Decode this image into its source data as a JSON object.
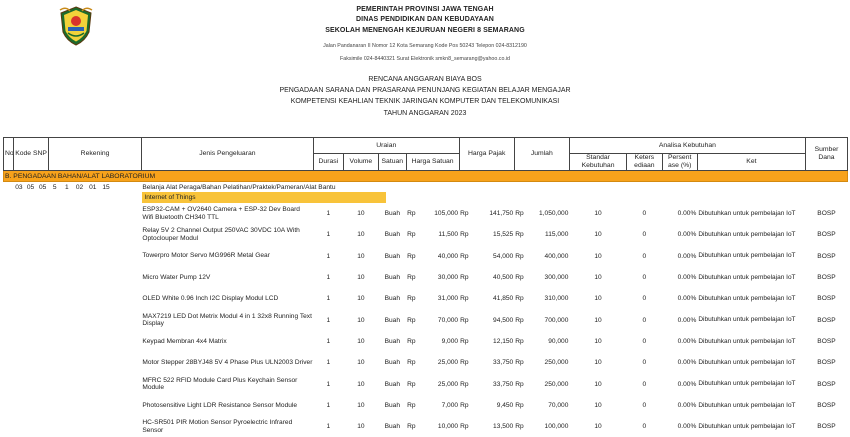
{
  "header": {
    "line1": "PEMERINTAH PROVINSI JAWA TENGAH",
    "line2": "DINAS PENDIDIKAN DAN KEBUDAYAAN",
    "line3": "SEKOLAH MENENGAH KEJURUAN NEGERI 8 SEMARANG",
    "address": "Jalan Pandanaran II Nomor 12 Kota Semarang Kode Pos 50243 Telepon 024-8312190",
    "fax": "Faksimile 024-8440321 Surat Elektronik smkn8_semarang@yahoo.co.id"
  },
  "titles": {
    "t1": "RENCANA ANGGARAN BIAYA BOS",
    "t2": "PENGADAAN SARANA DAN PRASARANA PENUNJANG KEGIATAN BELAJAR MENGAJAR",
    "t3": "KOMPETENSI KEAHLIAN TEKNIK JARINGAN KOMPUTER DAN TELEKOMUNIKASI",
    "t4": "TAHUN ANGGARAN 2023"
  },
  "columns": {
    "no": "No",
    "kode_snp": "Kode SNP",
    "rekening": "Rekening",
    "jenis": "Jenis Pengeluaran",
    "uraian": "Uraian",
    "durasi": "Durasi",
    "volume": "Volume",
    "satuan": "Satuan",
    "harga_satuan": "Harga Satuan",
    "harga_pajak": "Harga Pajak",
    "jumlah": "Jumlah",
    "analisa": "Analisa Kebutuhan",
    "standar": "Standar Kebutuhan",
    "keters": "Keters ediaan",
    "persent": "Persent ase (%)",
    "ket": "Ket",
    "sumber": "Sumber Dana"
  },
  "section": "B. PENGADAAN BAHAN/ALAT LABORATORIUM",
  "rekening_row": {
    "k1": "03",
    "k2": "05",
    "k3": "05",
    "k4": "5",
    "k5": "1",
    "k6": "02",
    "k7": "01",
    "k8": "15",
    "label": "Belanja Alat Peraga/Bahan Pelatihan/Praktek/Pameran/Alat Bantu"
  },
  "group": "Internet of Things",
  "items": [
    {
      "name": "ESP32-CAM + OV2640 Camera + ESP-32 Dev Board Wifi Bluetooth CH340 TTL",
      "durasi": "1",
      "volume": "10",
      "satuan": "Buah",
      "rp1": "Rp",
      "harga": "105,000",
      "rp2": "Rp",
      "pajak": "141,750",
      "rp3": "Rp",
      "jumlah": "1,050,000",
      "standar": "10",
      "ketersediaan": "0",
      "persen": "0.00%",
      "ket": "Dibutuhkan untuk pembelajan IoT",
      "sumber": "BOSP"
    },
    {
      "name": "Relay 5V 2 Channel Output 250VAC 30VDC 10A With Optoclouper Modul",
      "durasi": "1",
      "volume": "10",
      "satuan": "Buah",
      "rp1": "Rp",
      "harga": "11,500",
      "rp2": "Rp",
      "pajak": "15,525",
      "rp3": "Rp",
      "jumlah": "115,000",
      "standar": "10",
      "ketersediaan": "0",
      "persen": "0.00%",
      "ket": "Dibutuhkan untuk pembelajan IoT",
      "sumber": "BOSP"
    },
    {
      "name": "Towerpro Motor Servo MG996R Metal Gear",
      "durasi": "1",
      "volume": "10",
      "satuan": "Buah",
      "rp1": "Rp",
      "harga": "40,000",
      "rp2": "Rp",
      "pajak": "54,000",
      "rp3": "Rp",
      "jumlah": "400,000",
      "standar": "10",
      "ketersediaan": "0",
      "persen": "0.00%",
      "ket": "Dibutuhkan untuk pembelajan IoT",
      "sumber": "BOSP"
    },
    {
      "name": "Micro Water Pump 12V",
      "durasi": "1",
      "volume": "10",
      "satuan": "Buah",
      "rp1": "Rp",
      "harga": "30,000",
      "rp2": "Rp",
      "pajak": "40,500",
      "rp3": "Rp",
      "jumlah": "300,000",
      "standar": "10",
      "ketersediaan": "0",
      "persen": "0.00%",
      "ket": "Dibutuhkan untuk pembelajan IoT",
      "sumber": "BOSP"
    },
    {
      "name": "OLED White 0.96 Inch I2C Display Modul LCD",
      "durasi": "1",
      "volume": "10",
      "satuan": "Buah",
      "rp1": "Rp",
      "harga": "31,000",
      "rp2": "Rp",
      "pajak": "41,850",
      "rp3": "Rp",
      "jumlah": "310,000",
      "standar": "10",
      "ketersediaan": "0",
      "persen": "0.00%",
      "ket": "Dibutuhkan untuk pembelajan IoT",
      "sumber": "BOSP"
    },
    {
      "name": "MAX7219 LED Dot Metrix Modul 4 in 1 32x8 Running Text Display",
      "durasi": "1",
      "volume": "10",
      "satuan": "Buah",
      "rp1": "Rp",
      "harga": "70,000",
      "rp2": "Rp",
      "pajak": "94,500",
      "rp3": "Rp",
      "jumlah": "700,000",
      "standar": "10",
      "ketersediaan": "0",
      "persen": "0.00%",
      "ket": "Dibutuhkan untuk pembelajan IoT",
      "sumber": "BOSP"
    },
    {
      "name": "Keypad Membran 4x4 Matrix",
      "durasi": "1",
      "volume": "10",
      "satuan": "Buah",
      "rp1": "Rp",
      "harga": "9,000",
      "rp2": "Rp",
      "pajak": "12,150",
      "rp3": "Rp",
      "jumlah": "90,000",
      "standar": "10",
      "ketersediaan": "0",
      "persen": "0.00%",
      "ket": "Dibutuhkan untuk pembelajan IoT",
      "sumber": "BOSP"
    },
    {
      "name": "Motor Stepper 28BYJ48 5V 4 Phase Plus ULN2003 Driver",
      "durasi": "1",
      "volume": "10",
      "satuan": "Buah",
      "rp1": "Rp",
      "harga": "25,000",
      "rp2": "Rp",
      "pajak": "33,750",
      "rp3": "Rp",
      "jumlah": "250,000",
      "standar": "10",
      "ketersediaan": "0",
      "persen": "0.00%",
      "ket": "Dibutuhkan untuk pembelajan IoT",
      "sumber": "BOSP"
    },
    {
      "name": "MFRC 522 RFID Module Card Plus Keychain Sensor Module",
      "durasi": "1",
      "volume": "10",
      "satuan": "Buah",
      "rp1": "Rp",
      "harga": "25,000",
      "rp2": "Rp",
      "pajak": "33,750",
      "rp3": "Rp",
      "jumlah": "250,000",
      "standar": "10",
      "ketersediaan": "0",
      "persen": "0.00%",
      "ket": "Dibutuhkan untuk pembelajan IoT",
      "sumber": "BOSP"
    },
    {
      "name": "Photosensitive Light LDR Resistance Sensor Module",
      "durasi": "1",
      "volume": "10",
      "satuan": "Buah",
      "rp1": "Rp",
      "harga": "7,000",
      "rp2": "Rp",
      "pajak": "9,450",
      "rp3": "Rp",
      "jumlah": "70,000",
      "standar": "10",
      "ketersediaan": "0",
      "persen": "0.00%",
      "ket": "Dibutuhkan untuk pembelajan IoT",
      "sumber": "BOSP"
    },
    {
      "name": "HC-SR501 PIR Motion Sensor Pyroelectric Infrared Sensor",
      "durasi": "1",
      "volume": "10",
      "satuan": "Buah",
      "rp1": "Rp",
      "harga": "10,000",
      "rp2": "Rp",
      "pajak": "13,500",
      "rp3": "Rp",
      "jumlah": "100,000",
      "standar": "10",
      "ketersediaan": "0",
      "persen": "0.00%",
      "ket": "Dibutuhkan untuk pembelajan IoT",
      "sumber": "BOSP"
    }
  ]
}
